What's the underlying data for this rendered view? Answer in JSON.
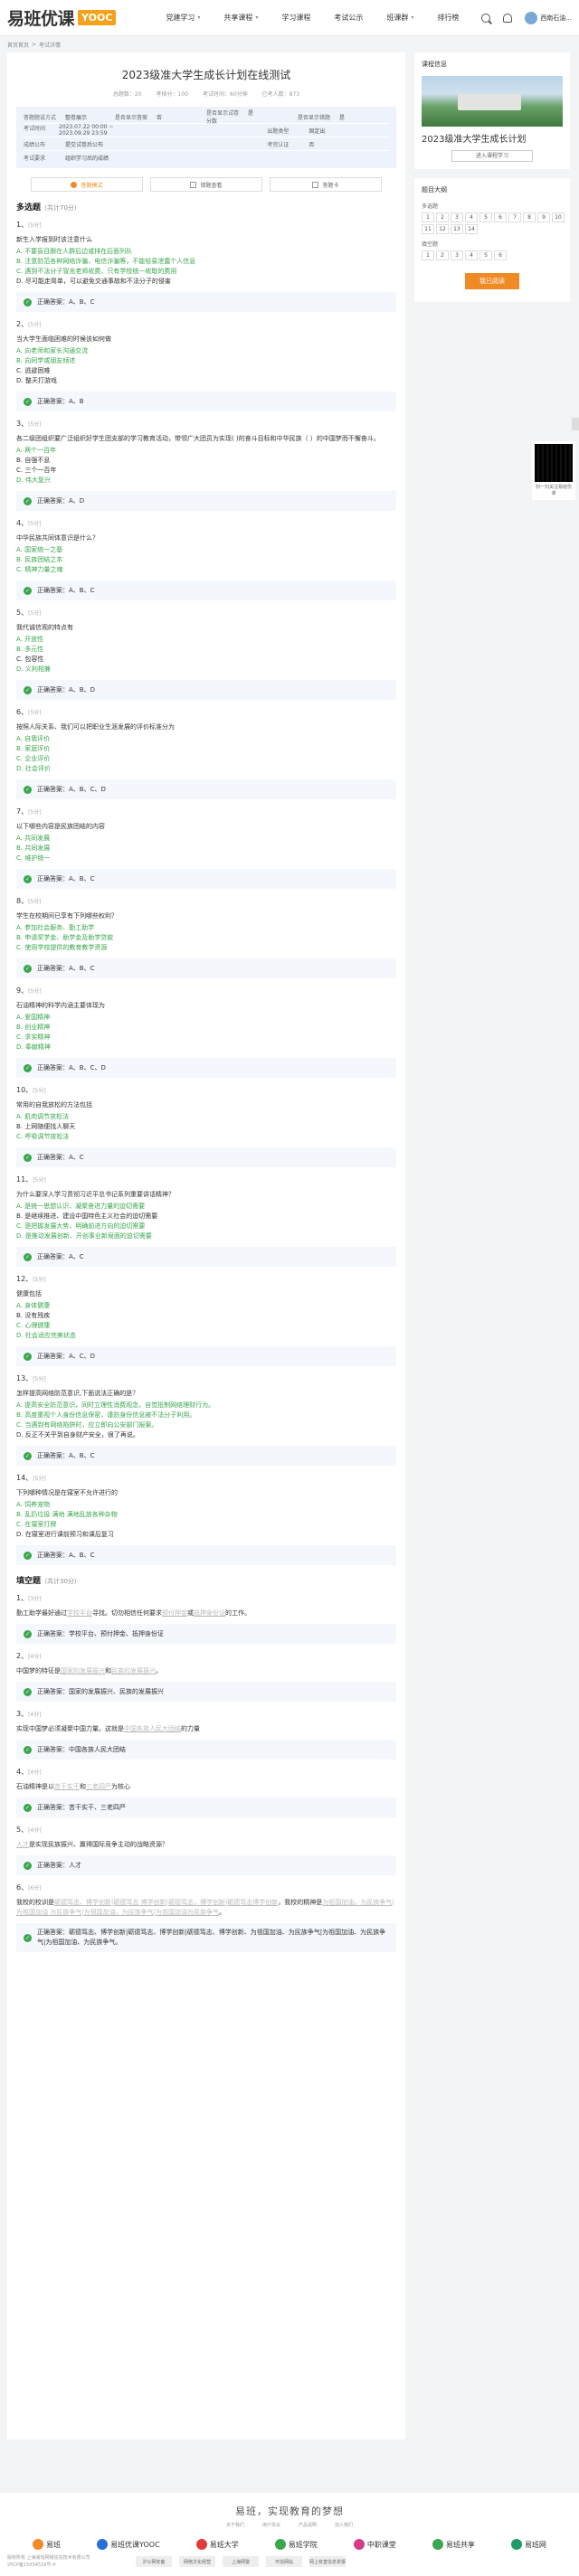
{
  "header": {
    "logo_text": "易班优课",
    "logo_box": "YOOC",
    "nav": [
      "党建学习",
      "共享课程",
      "学习课程",
      "考试公示",
      "班课群",
      "排行榜"
    ],
    "user_name": "西南石油..."
  },
  "breadcrumb": [
    "首页首页",
    "考试详情"
  ],
  "exam": {
    "title": "2023级准大学生成长计划在线测试",
    "stats": [
      "总题数：20",
      "考核分：100",
      "考试时间：60分钟",
      "已考人数：873"
    ],
    "info_rows": [
      [
        [
          "答题题设方式",
          "整卷展示"
        ],
        [
          "是否显示答案",
          "否"
        ],
        [
          "是否显示试卷分数",
          "是"
        ],
        [
          "是否显示错题",
          "是"
        ]
      ],
      [
        [
          "考试时间",
          "2023.07.22 00:00 ~ 2023.09.29 23:59"
        ],
        [
          "",
          ""
        ],
        [
          "出题类型",
          "固定出"
        ]
      ],
      [
        [
          "成绩公布",
          "提交试卷后公布"
        ],
        [
          "",
          ""
        ],
        [
          "考完认证",
          "否"
        ]
      ],
      [
        [
          "考试要求",
          "组织学习后的成绩"
        ]
      ]
    ]
  },
  "toolbar": {
    "tab1": "答题模式",
    "tab2": "错题查看",
    "tab3": "答题卡"
  },
  "sections": {
    "multi": {
      "title": "多选题",
      "sub": "（共计70分）"
    },
    "fill": {
      "title": "填空题",
      "sub": "（共计30分）"
    }
  },
  "answer_prefix": "正确答案：",
  "multi_questions": [
    {
      "n": "1、",
      "s": "[5分]",
      "text": "新生入学报到时该注意什么",
      "opts": [
        {
          "t": "A. 不要盲目跟在人群后边或排在后面列队",
          "c": true
        },
        {
          "t": "B. 注意防范各种网络诈骗、电信诈骗等，不能轻易泄露个人信息",
          "c": true
        },
        {
          "t": "C. 遇到不法分子冒充老师收费，只有学校统一收取的费用",
          "c": true
        },
        {
          "t": "D. 尽可能走简单，可以避免交通事故和不法分子的侵害",
          "c": false
        }
      ],
      "ans": "A、B、C"
    },
    {
      "n": "2、",
      "s": "[5分]",
      "text": "当大学生面临困难的时候该如何做",
      "opts": [
        {
          "t": "A. 向老师和家长沟通交流",
          "c": true
        },
        {
          "t": "B. 向同学或朋友倾述",
          "c": true
        },
        {
          "t": "C. 逃避困难",
          "c": false
        },
        {
          "t": "D. 整天打游戏",
          "c": false
        }
      ],
      "ans": "A、B"
    },
    {
      "n": "3、",
      "s": "[5分]",
      "text": "各二级团组织要广泛组织好学生团支部的学习教育活动，带领广大团员为实现( )的奋斗目标和中华民族（ ）的中国梦而不懈奋斗。",
      "opts": [
        {
          "t": "A. 两个一百年",
          "c": true
        },
        {
          "t": "B. 自强不息",
          "c": false
        },
        {
          "t": "C. 三个一百年",
          "c": false
        },
        {
          "t": "D. 伟大复兴",
          "c": true
        }
      ],
      "ans": "A、D"
    },
    {
      "n": "4、",
      "s": "[5分]",
      "text": "中华民族共同体意识是什么？",
      "opts": [
        {
          "t": "A. 国家统一之基",
          "c": true
        },
        {
          "t": "B. 民族团结之本",
          "c": true
        },
        {
          "t": "C. 精神力量之魂",
          "c": true
        }
      ],
      "ans": "A、B、C"
    },
    {
      "n": "5、",
      "s": "[5分]",
      "text": "我代诚信观的特点有",
      "opts": [
        {
          "t": "A. 开放性",
          "c": true
        },
        {
          "t": "B. 多元性",
          "c": true
        },
        {
          "t": "C. 包容性",
          "c": false
        },
        {
          "t": "D. 义利相兼",
          "c": true
        }
      ],
      "ans": "A、B、D"
    },
    {
      "n": "6、",
      "s": "[5分]",
      "text": "按照人际关系、我们可以把职业生涯发展的评价标准分为",
      "opts": [
        {
          "t": "A. 自我评价",
          "c": true
        },
        {
          "t": "B. 家庭评价",
          "c": true
        },
        {
          "t": "C. 企业评价",
          "c": true
        },
        {
          "t": "D. 社会评价",
          "c": true
        }
      ],
      "ans": "A、B、C、D"
    },
    {
      "n": "7、",
      "s": "[5分]",
      "text": "以下哪些内容是民族团结的内容",
      "opts": [
        {
          "t": "A. 共同发展",
          "c": true
        },
        {
          "t": "B. 共同发展",
          "c": true
        },
        {
          "t": "C. 维护统一",
          "c": true
        }
      ],
      "ans": "A、B、C"
    },
    {
      "n": "8、",
      "s": "[5分]",
      "text": "学生在校期间已享有下列哪些权利？",
      "opts": [
        {
          "t": "A. 参加社会服务、勤工助学",
          "c": true
        },
        {
          "t": "B. 申请奖学金、助学金及助学贷款",
          "c": true
        },
        {
          "t": "C. 使用学校提供的教育教学资源",
          "c": true
        }
      ],
      "ans": "A、B、C"
    },
    {
      "n": "9、",
      "s": "[5分]",
      "text": "石油精神的科学内涵主要体现为",
      "opts": [
        {
          "t": "A. 爱国精神",
          "c": true
        },
        {
          "t": "B. 创业精神",
          "c": true
        },
        {
          "t": "C. 求实精神",
          "c": true
        },
        {
          "t": "D. 奉献精神",
          "c": true
        }
      ],
      "ans": "A、B、C、D"
    },
    {
      "n": "10、",
      "s": "[5分]",
      "text": "常用的自我放松的方法包括",
      "opts": [
        {
          "t": "A. 肌肉调节放松法",
          "c": true
        },
        {
          "t": "B. 上网随便找人聊天",
          "c": false
        },
        {
          "t": "C. 呼吸调节放松法",
          "c": true
        }
      ],
      "ans": "A、C"
    },
    {
      "n": "11、",
      "s": "[5分]",
      "text": "为什么要深入学习贯彻习近平总书记系列重要讲话精神？",
      "opts": [
        {
          "t": "A. 是统一思想认识、凝聚奋进力量的迫切需要",
          "c": true
        },
        {
          "t": "B. 是继续推进、建设中国特色主义社会的迫切需要",
          "c": false
        },
        {
          "t": "C. 是把握发展大势、明确前进方向的迫切需要",
          "c": true
        },
        {
          "t": "D. 是推动发展创新、开创事业新局面的迫切需要",
          "c": true
        }
      ],
      "ans": "A、C"
    },
    {
      "n": "12、",
      "s": "[5分]",
      "text": "健康包括",
      "opts": [
        {
          "t": "A. 身体健康",
          "c": true
        },
        {
          "t": "B. 没有残疾",
          "c": false
        },
        {
          "t": "C. 心理健康",
          "c": true
        },
        {
          "t": "D. 社会适应完美状态",
          "c": true
        }
      ],
      "ans": "A、C、D"
    },
    {
      "n": "13、",
      "s": "[5分]",
      "text": "怎样提高网络防范意识,下面说法正确的是？",
      "opts": [
        {
          "t": "A. 提高安全防范意识，同时立理性消费观念，自觉抵制网络理财行为。",
          "c": true
        },
        {
          "t": "B. 高度重视个人身份信息保密，谨防身份信息被不法分子利用。",
          "c": true
        },
        {
          "t": "C. 当遇到有网络陷阱时，应立即向公安部门报案。",
          "c": true
        },
        {
          "t": "D. 反正不关乎到自身财产安全，很了再说。",
          "c": false
        }
      ],
      "ans": "A、B、C"
    },
    {
      "n": "14、",
      "s": "[5分]",
      "text": "下列哪种情况是在寝室不允许进行的",
      "opts": [
        {
          "t": "A. 饲养宠物",
          "c": true
        },
        {
          "t": "B. 乱扔垃圾 满地 满地乱放各种杂物",
          "c": true
        },
        {
          "t": "C. 在寝室打牌",
          "c": true
        },
        {
          "t": "D. 在寝室进行课前预习和课后复习",
          "c": false
        }
      ],
      "ans": "A、B、C"
    }
  ],
  "fill_questions": [
    {
      "n": "1、",
      "s": "[3分]",
      "parts": [
        "勤工助学最好通过",
        "学校平台",
        "寻找。切勿相信任何要求",
        "预付押金",
        "或",
        "抵押身份证",
        "的工作。"
      ],
      "ans": "学校平台、预付押金、抵押身份证"
    },
    {
      "n": "2、",
      "s": "[4分]",
      "parts": [
        "中国梦的特征是",
        "国家的发展振兴",
        "和",
        "民族的发展振兴",
        "。"
      ],
      "ans": "国家的发展振兴、民族的发展振兴"
    },
    {
      "n": "3、",
      "s": "[4分]",
      "parts": [
        "实现中国梦必须凝聚中国力量。这就是",
        "中国各族人民大团结",
        "的力量"
      ],
      "ans": "中国各族人民大团结"
    },
    {
      "n": "4、",
      "s": "[4分]",
      "parts": [
        "石油精神是以",
        "苦干实干",
        "和",
        "三老四严",
        "为核心"
      ],
      "ans": "苦干实干、三老四严"
    },
    {
      "n": "5、",
      "s": "[4分]",
      "parts": [
        "",
        "人才",
        "是实现民族振兴、赢得国际竞争主动的战略资源？"
      ],
      "ans": "人才"
    },
    {
      "n": "6、",
      "s": "[6分]",
      "parts": [
        "我校的校训是",
        "砺德笃志、博学创新|砺德笃志 博学创新|砺德笃志，博学创新|砺德笃志博学创新",
        "，我校的精神是",
        "为祖国加油，为民族争气|为祖国加油 为民族争气|为祖国加油，为民族争气|为祖国加油为民族争气",
        "。"
      ],
      "ans": "砺德笃志、博学创新|砺德笃志、博学创新|砺德笃志、博学创新、为祖国加油、为民族争气|为祖国加油、为民族争气|为祖国加油、为民族争气。"
    }
  ],
  "side": {
    "course_title": "课程信息",
    "course_name": "2023级准大学生成长计划",
    "enter_btn": "进入课程学习",
    "outline_title": "题目大纲",
    "multi_label": "多选题",
    "multi_nums": [
      "1",
      "2",
      "3",
      "4",
      "5",
      "6",
      "7",
      "8",
      "9",
      "10",
      "11",
      "12",
      "13",
      "14"
    ],
    "fill_label": "填空题",
    "fill_nums": [
      "1",
      "2",
      "3",
      "4",
      "5",
      "6"
    ],
    "submit_btn": "我已阅读"
  },
  "qr": {
    "label": "扫一扫关注易班优课"
  },
  "footer": {
    "slogan": "易班，实现教育的梦想",
    "links": [
      "关于我们",
      "用户协议",
      "产品说明",
      "加入我们"
    ],
    "partners": [
      "易班",
      "易班优课YOOC",
      "易班大学",
      "易班学院",
      "中职课堂",
      "易班共享",
      "易班网"
    ],
    "copyright": "版权所有 上海易班网络信息技术有限公司",
    "icp": "沪ICP备15034516号-9",
    "badges": [
      "沪公网安备",
      "网络文化经营",
      "上海网警",
      "可信网站",
      "网上有害信息举报"
    ]
  }
}
